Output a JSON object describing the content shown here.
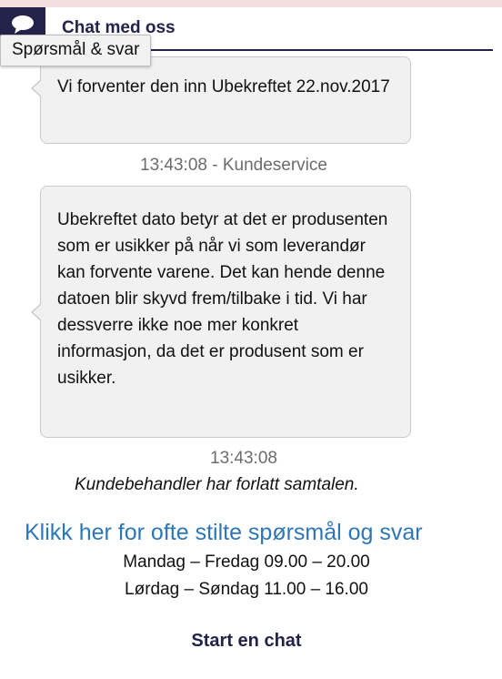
{
  "header": {
    "title": "Chat med oss",
    "icon": "chat-bubble-icon",
    "bar_color": "#23234a"
  },
  "tooltip": {
    "text": "Spørsmål & svar"
  },
  "messages": [
    {
      "text": "Vi forventer den inn Ubekreftet 22.nov.2017"
    },
    {
      "meta": "13:43:08 - Kundeservice"
    },
    {
      "text": "Ubekreftet dato betyr at det er produsenten som er usikker på når vi som leverandør kan forvente varene. Det kan hende denne datoen blir skyvd frem/tilbake i tid. Vi har dessverre ikke noe mer konkret informasjon, da det er produsent som er usikker."
    },
    {
      "meta": "13:43:08"
    }
  ],
  "status": {
    "left_text": "Kundebehandler har forlatt samtalen."
  },
  "faq": {
    "link_text": "Klikk her for ofte stilte spørsmål og svar",
    "link_color": "#2d77b8"
  },
  "hours": {
    "weekdays": "Mandag – Fredag 09.00 – 20.00",
    "weekend": "Lørdag – Søndag 11.00 – 16.00"
  },
  "actions": {
    "start_chat": "Start en chat"
  }
}
